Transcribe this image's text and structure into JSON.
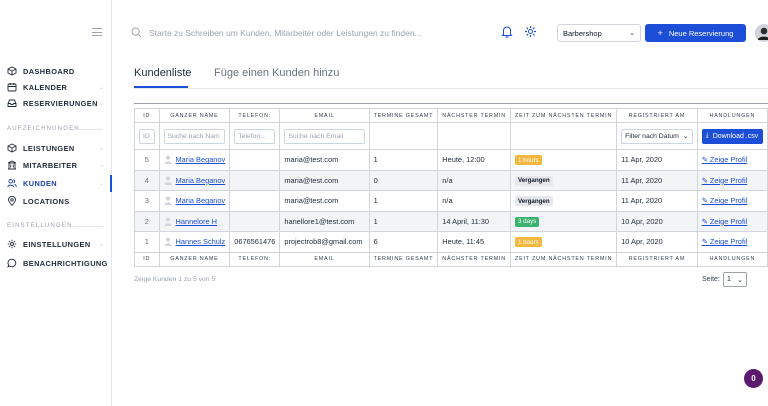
{
  "search": {
    "placeholder": "Starte zu Schreiben um Kunden, Mitarbeiter oder Leistungen zu finden..."
  },
  "header": {
    "shop_select": "Barbershop",
    "new_reservation": "Neue Reservierung"
  },
  "sidebar": {
    "items_top": [
      {
        "label": "DASHBOARD",
        "icon": "cube-icon"
      },
      {
        "label": "KALENDER",
        "icon": "calendar-icon"
      },
      {
        "label": "RESERVIERUNGEN",
        "icon": "inbox-icon"
      }
    ],
    "section1": "AUFZEICHNUNGEN",
    "items_mid": [
      {
        "label": "LEISTUNGEN",
        "icon": "cube-icon"
      },
      {
        "label": "MITARBEITER",
        "icon": "building-icon"
      },
      {
        "label": "KUNDEN",
        "icon": "users-icon"
      },
      {
        "label": "LOCATIONS",
        "icon": "location-icon"
      }
    ],
    "section2": "EINSTELLUNGEN",
    "items_bottom": [
      {
        "label": "EINSTELLUNGEN",
        "icon": "gear-icon"
      },
      {
        "label": "BENACHRICHTIGUNG",
        "icon": "chat-icon"
      }
    ]
  },
  "tabs": {
    "list": "Kundenliste",
    "add": "Füge einen Kunden hinzu"
  },
  "table": {
    "headers": [
      "ID",
      "GANZER NAME",
      "TELEFON:",
      "EMAIL",
      "TERMINE GESAMT",
      "NÄCHSTER TERMIN",
      "ZEIT ZUM NÄCHSTEN TERMIN",
      "REGISTRIERT AM",
      "HANDLUNGEN"
    ],
    "filters": {
      "id": "ID",
      "name": "Suche nach Nam",
      "phone": "Telefon...",
      "email": "Suche nach Email",
      "registered": "Filter nach Datum",
      "download": "Download .csv"
    },
    "rows": [
      {
        "id": "5",
        "name": "Maria Beganov",
        "phone": "",
        "email": "maria@test.com",
        "total": "1",
        "next": "Heute, 12:00",
        "time": "1 hours",
        "badge": "orange",
        "registered": "11 Apr, 2020",
        "action": "Zeige Profil"
      },
      {
        "id": "4",
        "name": "Maria Beganov",
        "phone": "",
        "email": "maria@test.com",
        "total": "0",
        "next": "n/a",
        "time": "Vergangen",
        "badge": "gray",
        "registered": "11 Apr, 2020",
        "action": "Zeige Profil"
      },
      {
        "id": "3",
        "name": "Maria Beganov",
        "phone": "",
        "email": "maria@test.com",
        "total": "1",
        "next": "n/a",
        "time": "Vergangen",
        "badge": "gray",
        "registered": "11 Apr, 2020",
        "action": "Zeige Profil"
      },
      {
        "id": "2",
        "name": "Hannelore H",
        "phone": "",
        "email": "hanellore1@test.com",
        "total": "1",
        "next": "14 April, 11:30",
        "time": "3 days",
        "badge": "green",
        "registered": "10 Apr, 2020",
        "action": "Zeige Profil"
      },
      {
        "id": "1",
        "name": "Hannes Schulz",
        "phone": "0676561476",
        "email": "projectrob8@gmail.com",
        "total": "6",
        "next": "Heute, 11:45",
        "time": "1 hours",
        "badge": "orange",
        "registered": "10 Apr, 2020",
        "action": "Zeige Profil"
      }
    ]
  },
  "footer": {
    "count": "Zeige Kunden 1 zu 5 von 5",
    "page_label": "Seite:",
    "page_value": "1"
  },
  "chat": {
    "count": "0"
  },
  "colors": {
    "accent": "#1d4ed8",
    "badge_orange": "#f4b740",
    "badge_green": "#3bb26f",
    "chat": "#5b1a6e"
  }
}
